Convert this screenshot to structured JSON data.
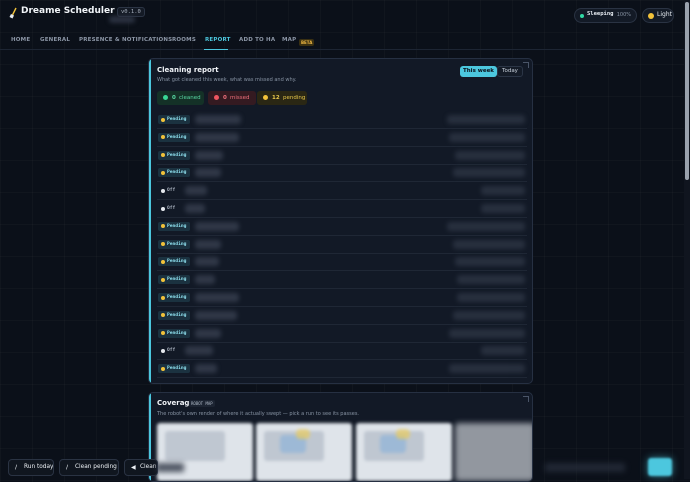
{
  "app": {
    "title": "Dreame Scheduler",
    "version": "v0.1.0",
    "status": {
      "label": "Sleeping",
      "battery": "100%"
    },
    "theme_toggle": "Light",
    "accent_color": "#4cc7de"
  },
  "nav": {
    "items": [
      "HOME",
      "GENERAL",
      "PRESENCE & NOTIFICATIONS",
      "ROOMS",
      "REPORT",
      "ADD TO HA",
      "MAP"
    ],
    "active": "REPORT",
    "map_badge": "BETA"
  },
  "report": {
    "title": "Cleaning report",
    "subtitle": "What got cleaned this week, what was missed and why.",
    "range_tabs": [
      "This week",
      "Today"
    ],
    "active_range": "This week",
    "summary": {
      "cleaned": {
        "count": "0",
        "label": "cleaned",
        "color": "#38d695"
      },
      "missed": {
        "count": "0",
        "label": "missed",
        "color": "#ee5560"
      },
      "pending": {
        "count": "12",
        "label": "pending",
        "color": "#f2c23a"
      }
    },
    "rows": [
      {
        "status": "Pending"
      },
      {
        "status": "Pending"
      },
      {
        "status": "Pending"
      },
      {
        "status": "Pending"
      },
      {
        "status": "Off"
      },
      {
        "status": "Off"
      },
      {
        "status": "Pending"
      },
      {
        "status": "Pending"
      },
      {
        "status": "Pending"
      },
      {
        "status": "Pending"
      },
      {
        "status": "Pending"
      },
      {
        "status": "Pending"
      },
      {
        "status": "Pending"
      },
      {
        "status": "Off"
      },
      {
        "status": "Pending"
      }
    ]
  },
  "coverage": {
    "title": "Coverage",
    "badge": "ROBOT MAP",
    "subtitle": "The robot's own render of where it actually swept — pick a run to see its passes."
  },
  "actions": {
    "run_today": "Run today",
    "clean_pending": "Clean pending",
    "third": "Clean"
  }
}
